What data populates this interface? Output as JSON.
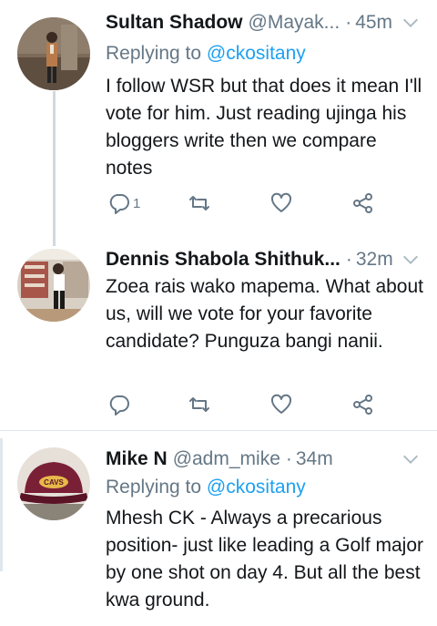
{
  "tweets": [
    {
      "name": "Sultan Shadow",
      "handle": "@Mayak...",
      "separator": "·",
      "time": "45m",
      "reply_prefix": "Replying to",
      "reply_to": "@ckositany",
      "text": "I follow WSR but that does it mean I'll vote for him. Just reading ujinga his bloggers write then we compare notes",
      "reply_count": "1",
      "avatar_bg": "#6b5a4a"
    },
    {
      "name": "Dennis Shabola Shithuk...",
      "handle": "",
      "separator": "·",
      "time": "32m",
      "text": "Zoea rais wako mapema. What about us, will we vote for your favorite candidate? Punguza bangi nanii.",
      "reply_count": "",
      "avatar_bg": "#c9c2b6"
    },
    {
      "name": "Mike N",
      "handle": "@adm_mike",
      "separator": "·",
      "time": "34m",
      "reply_prefix": "Replying to",
      "reply_to": "@ckositany",
      "text": "Mhesh CK - Always a precarious position- just like leading a Golf major by one shot on day 4. But all the best kwa ground.",
      "avatar_bg": "#7a2036"
    }
  ],
  "icons": {
    "reply": "reply-icon",
    "retweet": "retweet-icon",
    "like": "heart-icon",
    "share": "share-icon",
    "more": "chevron-down-icon"
  },
  "colors": {
    "link": "#1da1f2",
    "muted": "#657786",
    "text": "#14171a",
    "divider": "#e1e8ed"
  }
}
